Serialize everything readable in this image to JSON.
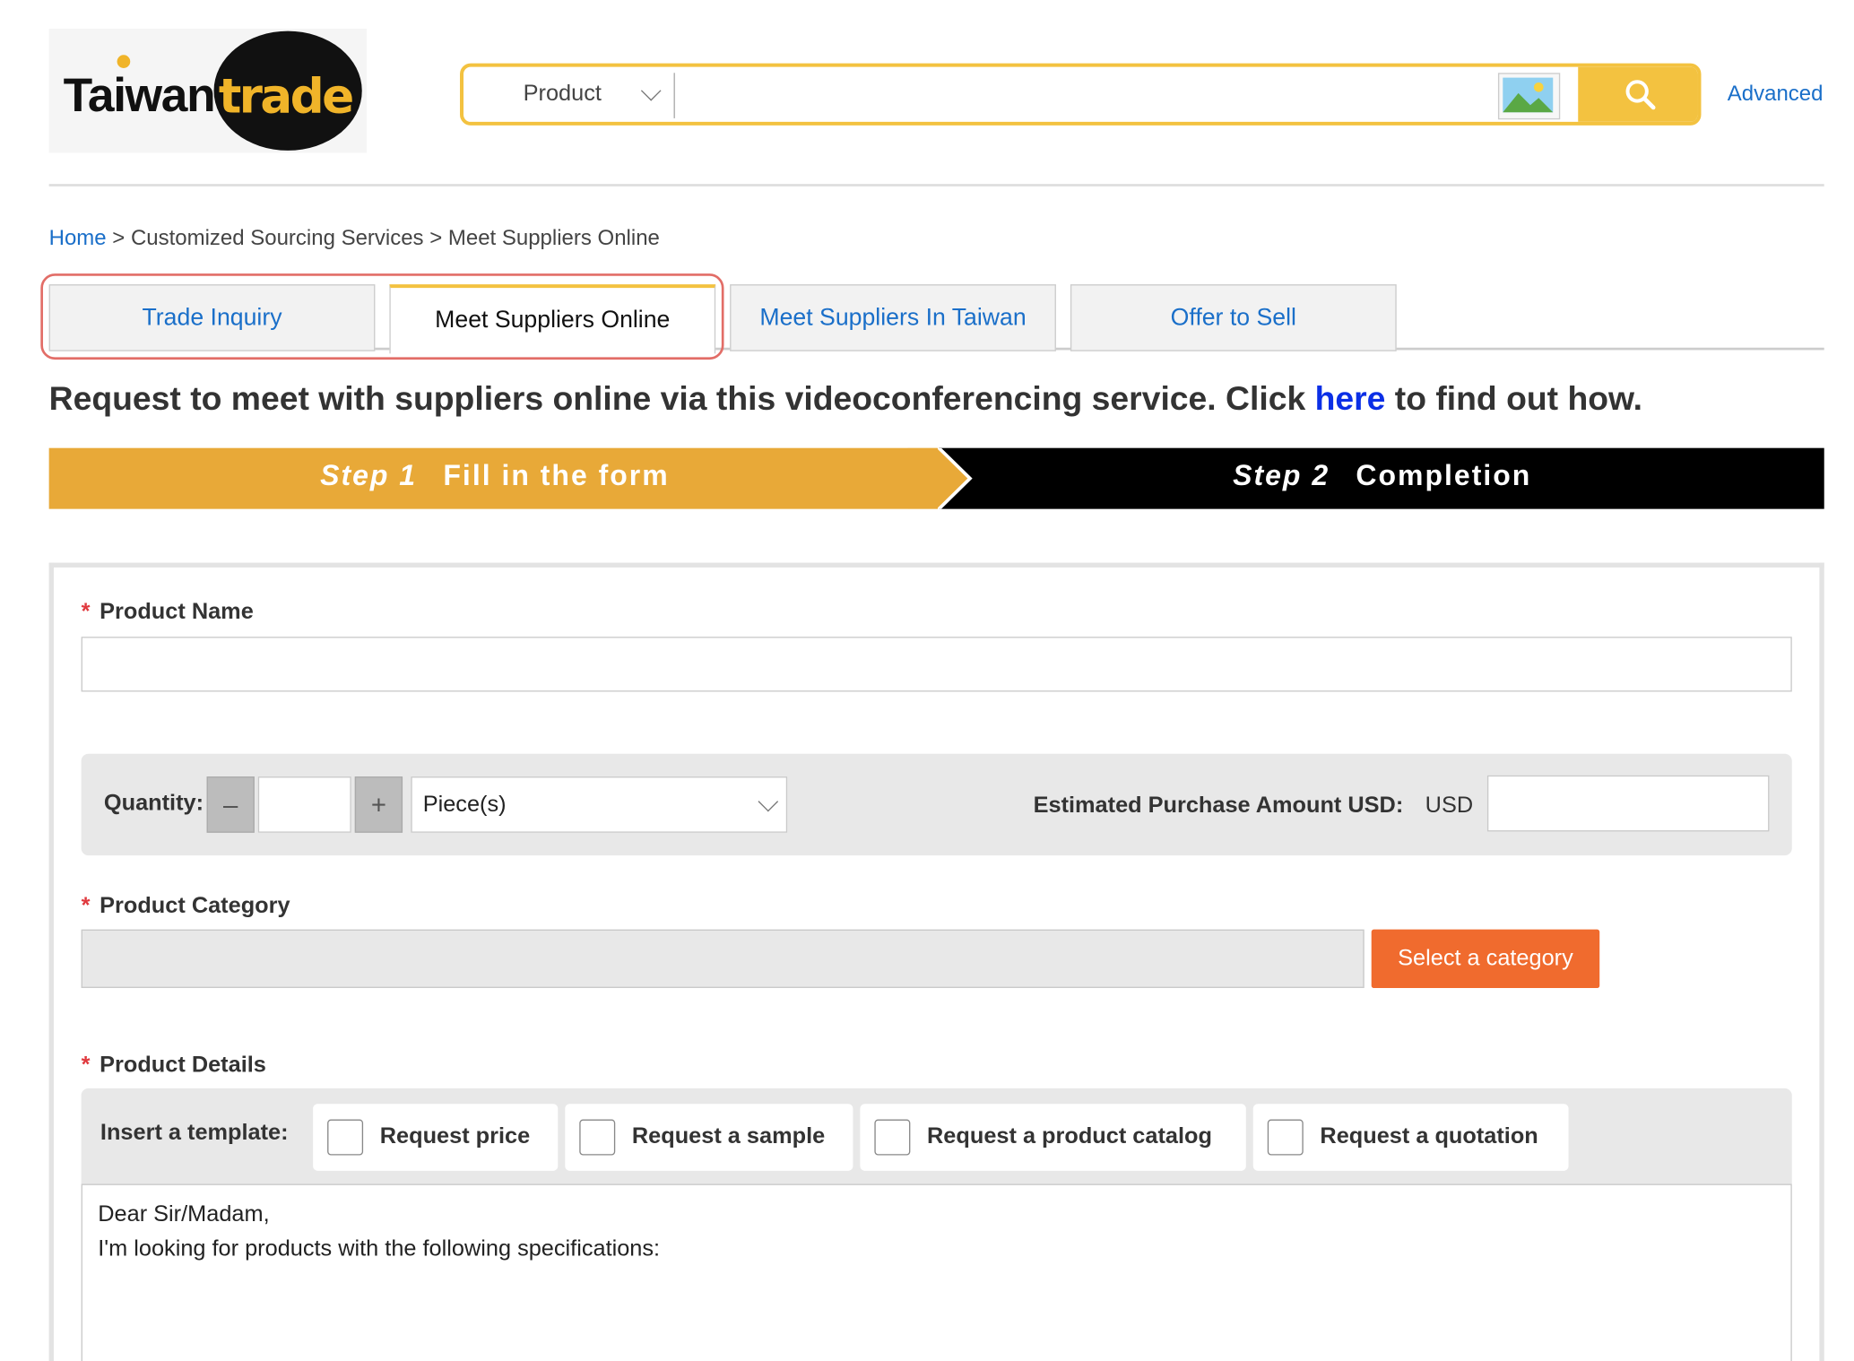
{
  "header": {
    "logo_text": "Taiwantrade",
    "search_category": "Product",
    "search_placeholder": "",
    "advanced_label": "Advanced"
  },
  "breadcrumb": {
    "home": "Home",
    "separator1": " > ",
    "level2": "Customized Sourcing Services",
    "separator2": " > ",
    "current": "Meet Suppliers Online"
  },
  "tabs": [
    {
      "label": "Trade Inquiry",
      "active": false
    },
    {
      "label": "Meet Suppliers Online",
      "active": true
    },
    {
      "label": "Meet Suppliers In Taiwan",
      "active": false
    },
    {
      "label": "Offer to Sell",
      "active": false
    }
  ],
  "intro": {
    "before": "Request to meet with suppliers online via this videoconferencing service. Click ",
    "link": "here",
    "after": " to find out how."
  },
  "steps": [
    {
      "num": "Step 1",
      "label": "Fill in the form",
      "active": true
    },
    {
      "num": "Step 2",
      "label": "Completion",
      "active": false
    }
  ],
  "form": {
    "product_name_label": "Product Name",
    "product_name_value": "",
    "quantity_label": "Quantity:",
    "quantity_minus": "–",
    "quantity_plus": "+",
    "quantity_value": "",
    "unit_selected": "Piece(s)",
    "estimated_label": "Estimated Purchase Amount USD:",
    "estimated_currency": "USD",
    "estimated_value": "",
    "category_label": "Product Category",
    "category_value": "",
    "category_button": "Select a category",
    "details_label": "Product Details",
    "template_label": "Insert a template:",
    "templates": [
      "Request price",
      "Request a sample",
      "Request a product catalog",
      "Request a quotation"
    ],
    "details_line1": "Dear Sir/Madam,",
    "details_line2": "I'm looking for products with the following specifications:"
  },
  "colors": {
    "brand_yellow": "#f3c240",
    "step_active": "#e8a938",
    "link_blue": "#1a6fc9",
    "category_button": "#f06b2e",
    "required_star": "#e0393e",
    "tab_highlight": "#e26d67"
  }
}
